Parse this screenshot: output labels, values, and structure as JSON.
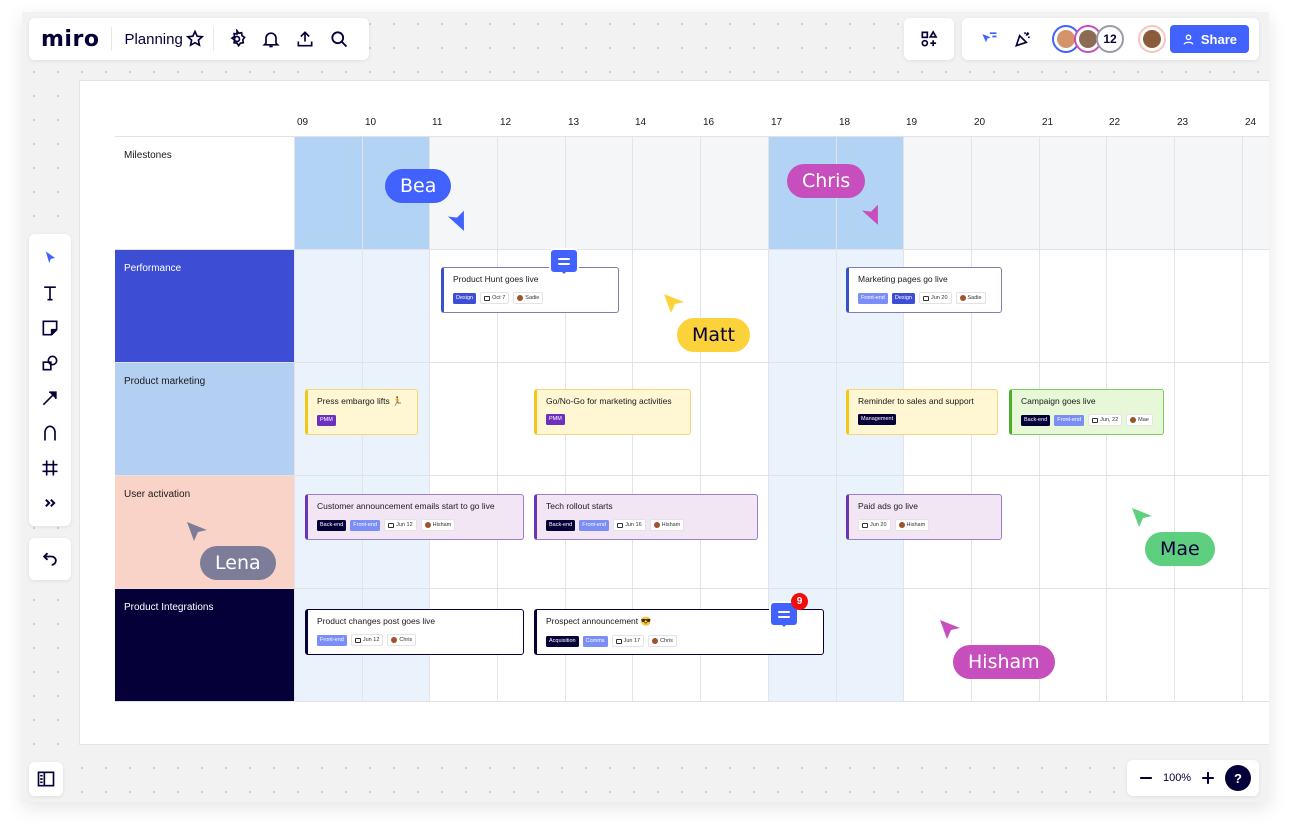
{
  "app": {
    "logo": "miro",
    "board_title": "Planning",
    "toolbar_icons": [
      "star-icon",
      "gear-icon",
      "bell-icon",
      "upload-icon",
      "search-icon"
    ],
    "collaborator_count": "12",
    "share_label": "Share",
    "zoom_level": "100%",
    "help_label": "?"
  },
  "tools": [
    "select",
    "text",
    "sticky-note",
    "shapes",
    "arrow",
    "pen",
    "frame",
    "more"
  ],
  "timeline": {
    "hours": [
      "09",
      "10",
      "11",
      "12",
      "13",
      "14",
      "16",
      "17",
      "18",
      "19",
      "20",
      "21",
      "22",
      "23",
      "24"
    ],
    "rows": [
      {
        "label": "Milestones",
        "bg": "#ffffff",
        "text": "#1a1a1a"
      },
      {
        "label": "Performance",
        "bg": "#3d4ed5",
        "text": "#ffffff"
      },
      {
        "label": "Product marketing",
        "bg": "#b3d0f2",
        "text": "#1a1a1a"
      },
      {
        "label": "User activation",
        "bg": "#fad3c8",
        "text": "#1a1a1a"
      },
      {
        "label": "Product Integrations",
        "bg": "#050038",
        "text": "#ffffff"
      }
    ]
  },
  "cards": [
    {
      "title": "Product Hunt goes live",
      "tags": [
        {
          "label": "Design",
          "color": "#3d4ed5"
        }
      ],
      "date": "Oct 7",
      "owner": "Sadie"
    },
    {
      "title": "Marketing pages go live",
      "tags": [
        {
          "label": "Front-end",
          "color": "#7b8ef5"
        },
        {
          "label": "Design",
          "color": "#3d4ed5"
        }
      ],
      "date": "Jun 20",
      "owner": "Sadie"
    },
    {
      "title": "Press embargo lifts 🏃",
      "tags": [
        {
          "label": "PMM",
          "color": "#6c2fbf"
        }
      ]
    },
    {
      "title": "Go/No-Go for marketing activities",
      "tags": [
        {
          "label": "PMM",
          "color": "#6c2fbf"
        }
      ]
    },
    {
      "title": "Reminder to sales and support",
      "tags": [
        {
          "label": "Management",
          "color": "#050038"
        }
      ]
    },
    {
      "title": "Campaign goes live",
      "tags": [
        {
          "label": "Back-end",
          "color": "#050038"
        },
        {
          "label": "Front-end",
          "color": "#7b8ef5"
        }
      ],
      "date": "Jun, 22",
      "owner": "Mae"
    },
    {
      "title": "Customer announcement emails start to go live",
      "tags": [
        {
          "label": "Back-end",
          "color": "#050038"
        },
        {
          "label": "Front-end",
          "color": "#7b8ef5"
        }
      ],
      "date": "Jun 12",
      "owner": "Hisham"
    },
    {
      "title": "Tech rollout starts",
      "tags": [
        {
          "label": "Back-end",
          "color": "#050038"
        },
        {
          "label": "Front-end",
          "color": "#7b8ef5"
        }
      ],
      "date": "Jun 16",
      "owner": "Hisham"
    },
    {
      "title": "Paid ads go live",
      "tags": [],
      "date": "Jun 20",
      "owner": "Hisham"
    },
    {
      "title": "Product changes post goes live",
      "tags": [
        {
          "label": "Front-end",
          "color": "#7b8ef5"
        }
      ],
      "date": "Jun 12",
      "owner": "Chris"
    },
    {
      "title": "Prospect announcement 😎",
      "tags": [
        {
          "label": "Acquisition",
          "color": "#050038"
        },
        {
          "label": "Comms",
          "color": "#7b8ef5"
        }
      ],
      "date": "Jun 17",
      "owner": "Chris"
    }
  ],
  "comments": {
    "badge_count": "9"
  },
  "cursors": [
    {
      "name": "Bea",
      "color": "#4262ff",
      "text": "#ffffff"
    },
    {
      "name": "Chris",
      "color": "#c64fbd",
      "text": "#ffffff"
    },
    {
      "name": "Matt",
      "color": "#fcd23b",
      "text": "#050038"
    },
    {
      "name": "Lena",
      "color": "#7d7d99",
      "text": "#ffffff"
    },
    {
      "name": "Mae",
      "color": "#5dcf7f",
      "text": "#050038"
    },
    {
      "name": "Hisham",
      "color": "#c64fbd",
      "text": "#ffffff"
    }
  ],
  "colors": {
    "accent": "#4262ff",
    "highlight_column": "#b3d3f5",
    "highlight_column_light": "#eaf2fc"
  }
}
